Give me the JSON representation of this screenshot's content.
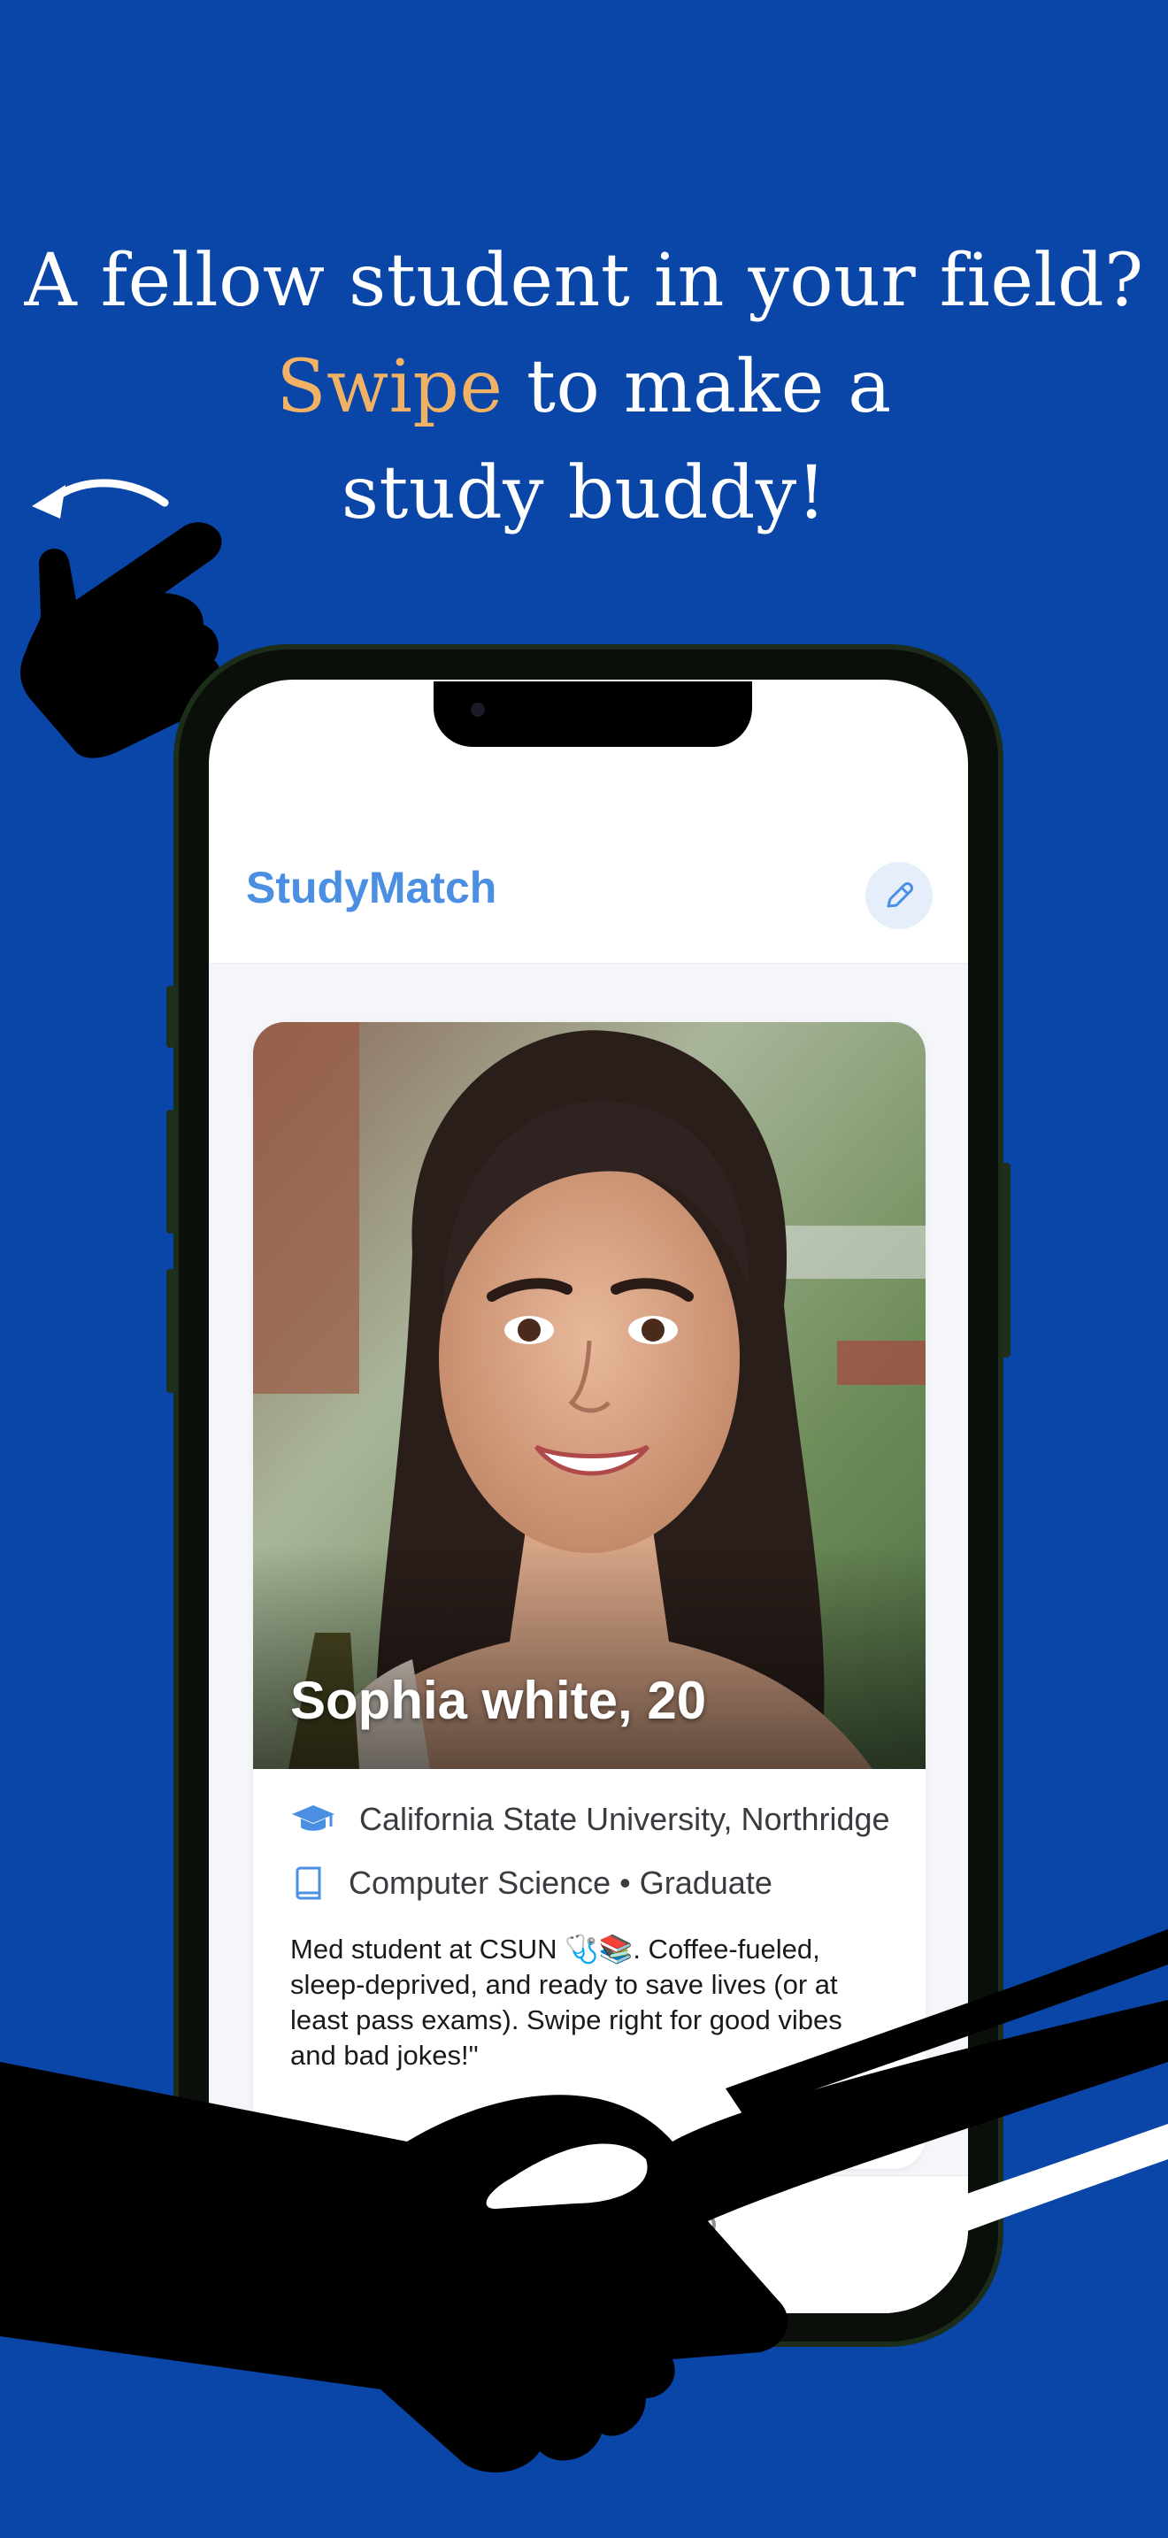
{
  "headline": {
    "line1": "A fellow student in your field?",
    "accent_word": "Swipe",
    "line2_rest": " to make a",
    "line3": "study buddy!"
  },
  "colors": {
    "background": "#0a45a8",
    "accent": "#f2b266",
    "brand": "#4a8fe2",
    "active_tab": "#3a7be0"
  },
  "app": {
    "title": "StudyMatch",
    "edit_icon": "pencil-icon"
  },
  "profile": {
    "name_age": "Sophia white, 20",
    "university": "California State University, Northridge",
    "major_line": "Computer Science • Graduate",
    "bio": "Med student at CSUN 🩺📚. Coffee-fueled, sleep-deprived, and ready to save lives (or at least pass exams). Swipe right for good vibes and bad jokes!\"",
    "university_icon": "graduation-cap-icon",
    "major_icon": "book-icon"
  },
  "tabs": [
    {
      "icon": "people-icon",
      "active": true
    },
    {
      "icon": "search-icon",
      "active": false
    },
    {
      "icon": "profile-icon",
      "active": false
    }
  ]
}
